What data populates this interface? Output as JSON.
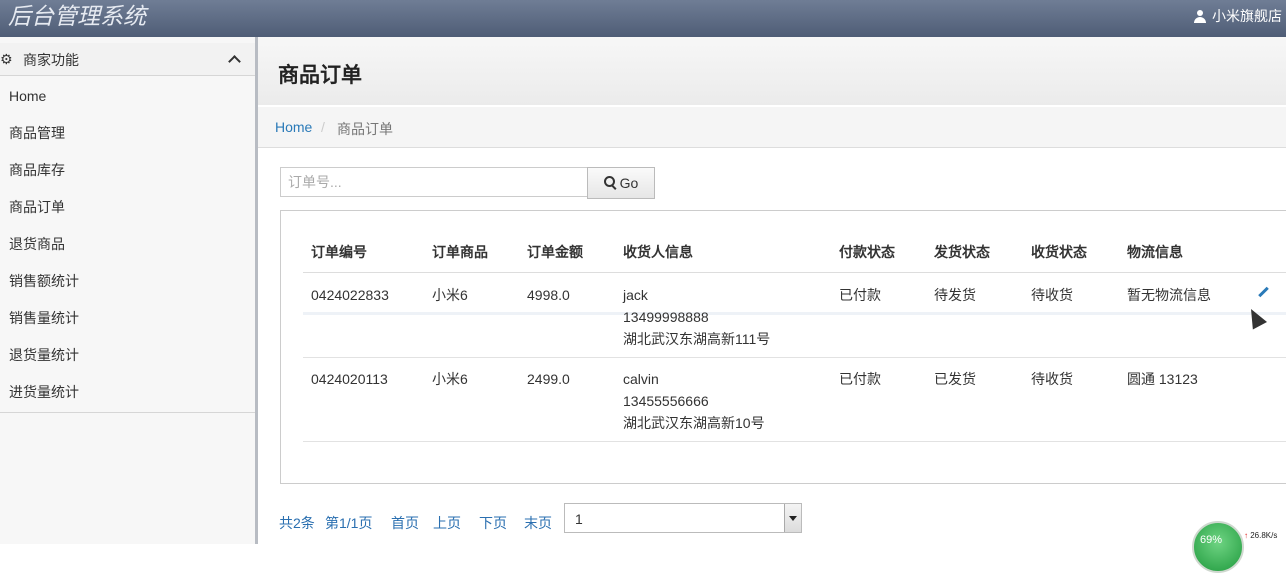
{
  "app": {
    "title": "后台管理系统",
    "user": "小米旗舰店"
  },
  "sidebar": {
    "section_title": "商家功能",
    "items": [
      {
        "label": "Home"
      },
      {
        "label": "商品管理"
      },
      {
        "label": "商品库存"
      },
      {
        "label": "商品订单"
      },
      {
        "label": "退货商品"
      },
      {
        "label": "销售额统计"
      },
      {
        "label": "销售量统计"
      },
      {
        "label": "退货量统计"
      },
      {
        "label": "进货量统计"
      }
    ]
  },
  "page": {
    "title": "商品订单",
    "breadcrumb": {
      "home": "Home",
      "separator": "/",
      "current": "商品订单"
    }
  },
  "search": {
    "placeholder": "订单号...",
    "value": "",
    "button_label": "Go"
  },
  "table": {
    "headers": [
      "订单编号",
      "订单商品",
      "订单金额",
      "收货人信息",
      "付款状态",
      "发货状态",
      "收货状态",
      "物流信息"
    ],
    "rows": [
      {
        "order_id": "0424022833",
        "product": "小米6",
        "amount": "4998.0",
        "receiver_name": "jack",
        "receiver_phone": "13499998888",
        "receiver_addr": "湖北武汉东湖高新111号",
        "pay_status": "已付款",
        "ship_status": "待发货",
        "receive_status": "待收货",
        "logistics": "暂无物流信息"
      },
      {
        "order_id": "0424020113",
        "product": "小米6",
        "amount": "2499.0",
        "receiver_name": "calvin",
        "receiver_phone": "13455556666",
        "receiver_addr": "湖北武汉东湖高新10号",
        "pay_status": "已付款",
        "ship_status": "已发货",
        "receive_status": "待收货",
        "logistics": "圆通 13123"
      }
    ]
  },
  "pagination": {
    "total": "共2条",
    "page_info": "第1/1页",
    "first": "首页",
    "prev": "上页",
    "next": "下页",
    "last": "末页",
    "selected_page": "1"
  },
  "net_widget": {
    "percent": "69%",
    "speed": "26.8K/s"
  },
  "colors": {
    "link": "#2a7ab8",
    "topbar": "#5a6882",
    "net": "#2fae4e"
  }
}
